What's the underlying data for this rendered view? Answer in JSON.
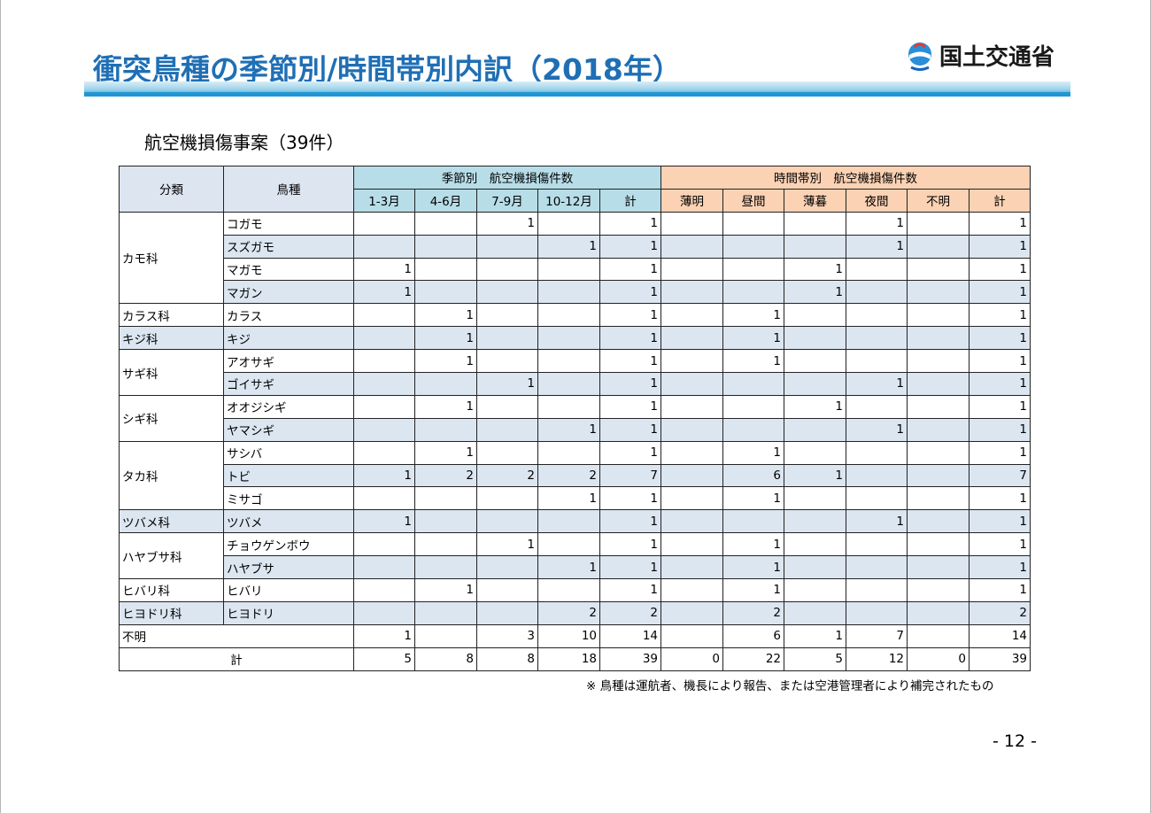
{
  "title": "衝突鳥種の季節別/時間帯別内訳（2018年）",
  "logo_text": "国土交通省",
  "subtitle": "航空機損傷事案（39件）",
  "table": {
    "h_category": "分類",
    "h_species": "鳥種",
    "h_season_group": "季節別　航空機損傷件数",
    "h_time_group": "時間帯別　航空機損傷件数",
    "season_cols": [
      "1-3月",
      "4-6月",
      "7-9月",
      "10-12月",
      "計"
    ],
    "time_cols": [
      "薄明",
      "昼間",
      "薄暮",
      "夜間",
      "不明",
      "計"
    ],
    "rows": [
      {
        "family": "カモ科",
        "species": "コガモ",
        "season": [
          "",
          "",
          "1",
          "",
          "1"
        ],
        "time": [
          "",
          "",
          "",
          "1",
          "",
          "1"
        ]
      },
      {
        "family": "",
        "species": "スズガモ",
        "season": [
          "",
          "",
          "",
          "1",
          "1"
        ],
        "time": [
          "",
          "",
          "",
          "1",
          "",
          "1"
        ]
      },
      {
        "family": "",
        "species": "マガモ",
        "season": [
          "1",
          "",
          "",
          "",
          "1"
        ],
        "time": [
          "",
          "",
          "1",
          "",
          "",
          "1"
        ]
      },
      {
        "family": "",
        "species": "マガン",
        "season": [
          "1",
          "",
          "",
          "",
          "1"
        ],
        "time": [
          "",
          "",
          "1",
          "",
          "",
          "1"
        ]
      },
      {
        "family": "カラス科",
        "species": "カラス",
        "season": [
          "",
          "1",
          "",
          "",
          "1"
        ],
        "time": [
          "",
          "1",
          "",
          "",
          "",
          "1"
        ]
      },
      {
        "family": "キジ科",
        "species": "キジ",
        "season": [
          "",
          "1",
          "",
          "",
          "1"
        ],
        "time": [
          "",
          "1",
          "",
          "",
          "",
          "1"
        ]
      },
      {
        "family": "サギ科",
        "species": "アオサギ",
        "season": [
          "",
          "1",
          "",
          "",
          "1"
        ],
        "time": [
          "",
          "1",
          "",
          "",
          "",
          "1"
        ]
      },
      {
        "family": "",
        "species": "ゴイサギ",
        "season": [
          "",
          "",
          "1",
          "",
          "1"
        ],
        "time": [
          "",
          "",
          "",
          "1",
          "",
          "1"
        ]
      },
      {
        "family": "シギ科",
        "species": "オオジシギ",
        "season": [
          "",
          "1",
          "",
          "",
          "1"
        ],
        "time": [
          "",
          "",
          "1",
          "",
          "",
          "1"
        ]
      },
      {
        "family": "",
        "species": "ヤマシギ",
        "season": [
          "",
          "",
          "",
          "1",
          "1"
        ],
        "time": [
          "",
          "",
          "",
          "1",
          "",
          "1"
        ]
      },
      {
        "family": "タカ科",
        "species": "サシバ",
        "season": [
          "",
          "1",
          "",
          "",
          "1"
        ],
        "time": [
          "",
          "1",
          "",
          "",
          "",
          "1"
        ]
      },
      {
        "family": "",
        "species": "トビ",
        "season": [
          "1",
          "2",
          "2",
          "2",
          "7"
        ],
        "time": [
          "",
          "6",
          "1",
          "",
          "",
          "7"
        ]
      },
      {
        "family": "",
        "species": "ミサゴ",
        "season": [
          "",
          "",
          "",
          "1",
          "1"
        ],
        "time": [
          "",
          "1",
          "",
          "",
          "",
          "1"
        ]
      },
      {
        "family": "ツバメ科",
        "species": "ツバメ",
        "season": [
          "1",
          "",
          "",
          "",
          "1"
        ],
        "time": [
          "",
          "",
          "",
          "1",
          "",
          "1"
        ]
      },
      {
        "family": "ハヤブサ科",
        "species": "チョウゲンボウ",
        "season": [
          "",
          "",
          "1",
          "",
          "1"
        ],
        "time": [
          "",
          "1",
          "",
          "",
          "",
          "1"
        ]
      },
      {
        "family": "",
        "species": "ハヤブサ",
        "season": [
          "",
          "",
          "",
          "1",
          "1"
        ],
        "time": [
          "",
          "1",
          "",
          "",
          "",
          "1"
        ]
      },
      {
        "family": "ヒバリ科",
        "species": "ヒバリ",
        "season": [
          "",
          "1",
          "",
          "",
          "1"
        ],
        "time": [
          "",
          "1",
          "",
          "",
          "",
          "1"
        ]
      },
      {
        "family": "ヒヨドリ科",
        "species": "ヒヨドリ",
        "season": [
          "",
          "",
          "",
          "2",
          "2"
        ],
        "time": [
          "",
          "2",
          "",
          "",
          "",
          "2"
        ]
      }
    ],
    "unknown_row": {
      "label": "不明",
      "season": [
        "1",
        "",
        "3",
        "10",
        "14"
      ],
      "time": [
        "",
        "6",
        "1",
        "7",
        "",
        "14"
      ]
    },
    "total_row": {
      "label": "計",
      "season": [
        "5",
        "8",
        "8",
        "18",
        "39"
      ],
      "time": [
        "0",
        "22",
        "5",
        "12",
        "0",
        "39"
      ]
    }
  },
  "footnote": "※ 鳥種は運航者、機長により報告、または空港管理者により補完されたもの",
  "page_number": "- 12 -"
}
